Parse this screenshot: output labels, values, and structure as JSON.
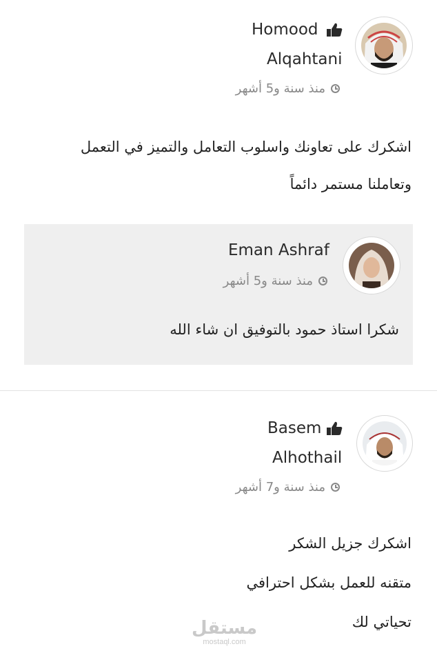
{
  "reviews": [
    {
      "name_first": "Homood",
      "name_last": "Alqahtani",
      "time": "منذ سنة و5 أشهر",
      "comment_lines": [
        "اشكرك على تعاونك واسلوب التعامل والتميز في التعمل",
        "وتعاملنا مستمر دائماً"
      ],
      "reply": {
        "name": "Eman Ashraf",
        "time": "منذ سنة و5 أشهر",
        "text": "شكرا استاذ حمود بالتوفيق ان شاء الله"
      }
    },
    {
      "name_first": "Basem",
      "name_last": "Alhothail",
      "time": "منذ سنة و7 أشهر",
      "comment_lines": [
        "اشكرك جزيل الشكر",
        "متقنه للعمل بشكل احترافي",
        "تحياتي لك"
      ]
    }
  ],
  "watermark": {
    "main": "مستقل",
    "sub": "mostaql.com"
  },
  "icons": {
    "thumb": "thumbs-up-icon",
    "clock": "clock-icon"
  },
  "colors": {
    "text": "#222222",
    "muted": "#888888",
    "reply_bg": "#efefef"
  }
}
